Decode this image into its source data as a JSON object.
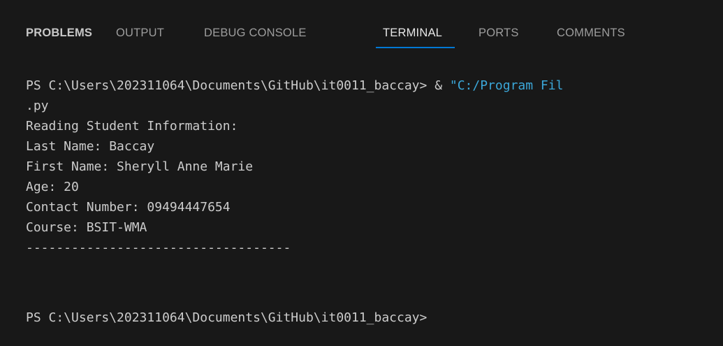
{
  "tabs": [
    {
      "label": "PROBLEMS",
      "active": false
    },
    {
      "label": "OUTPUT",
      "active": false
    },
    {
      "label": "DEBUG CONSOLE",
      "active": false
    },
    {
      "label": "TERMINAL",
      "active": true
    },
    {
      "label": "PORTS",
      "active": false
    },
    {
      "label": "COMMENTS",
      "active": false
    }
  ],
  "terminal": {
    "command_prompt": "PS C:\\Users\\202311064\\Documents\\GitHub\\it0011_baccay> & ",
    "command_string": "\"C:/Program Fil",
    "lines": [
      ".py",
      "Reading Student Information:",
      "Last Name: Baccay",
      "First Name: Sheryll Anne Marie",
      "Age: 20",
      "Contact Number: 09494447654",
      "Course: BSIT-WMA",
      "-----------------------------------",
      "",
      "PS C:\\Users\\202311064\\Documents\\GitHub\\it0011_baccay>"
    ]
  },
  "colors": {
    "background": "#181818",
    "text": "#cccccc",
    "tab_inactive": "#9d9d9d",
    "tab_active": "#e7e7e7",
    "accent": "#0078d4",
    "string": "#3ba7d9"
  }
}
